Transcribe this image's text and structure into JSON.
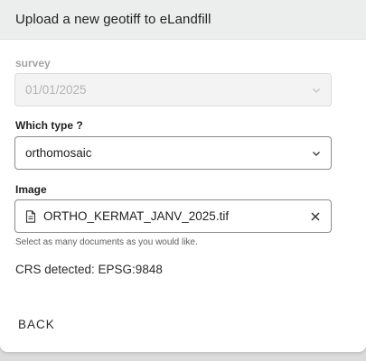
{
  "dialog": {
    "title": "Upload a new geotiff to eLandfill"
  },
  "survey": {
    "label": "survey",
    "value": "01/01/2025",
    "disabled": true
  },
  "type_field": {
    "label": "Which type ?",
    "value": "orthomosaic"
  },
  "image_field": {
    "label": "Image",
    "file_name": "ORTHO_KERMAT_JANV_2025.tif",
    "helper": "Select as many documents as you would like."
  },
  "crs": {
    "text": "CRS detected: EPSG:9848"
  },
  "actions": {
    "back_label": "BACK"
  },
  "icons": {
    "select_chevron": "chevron-down-icon",
    "file": "file-icon",
    "clear": "close-icon"
  },
  "colors": {
    "header_bg": "#eceeed",
    "border": "#8a8a8a",
    "disabled_text": "#b3b3b3"
  }
}
